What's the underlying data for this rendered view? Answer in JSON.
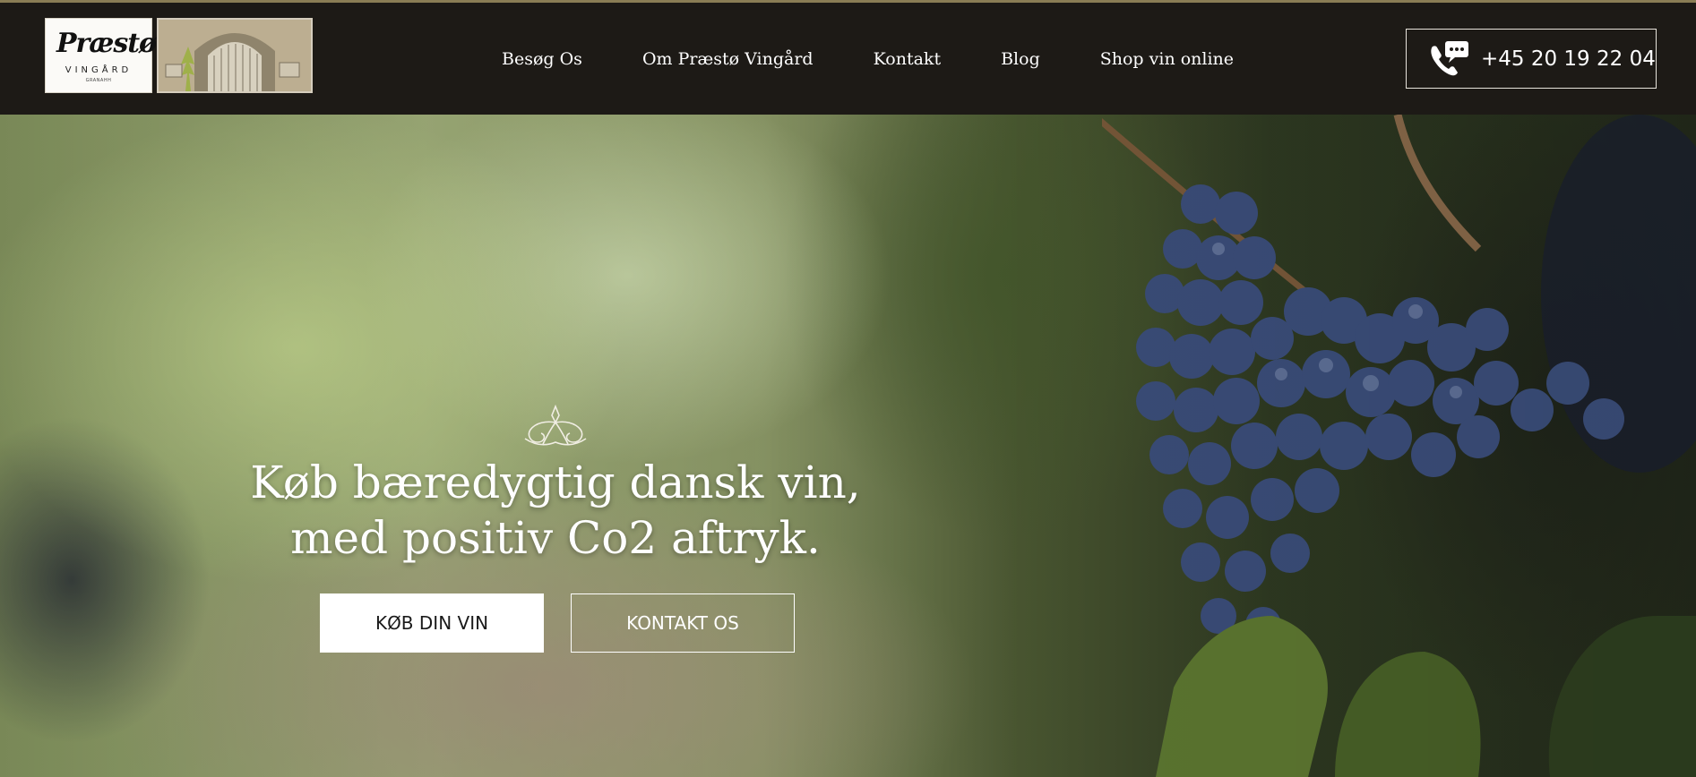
{
  "brand": {
    "logo_text": "Præstø",
    "logo_subtitle": "VINGÅRD",
    "logo_tiny": "GRANAHH"
  },
  "nav": {
    "items": [
      {
        "label": "Besøg Os"
      },
      {
        "label": "Om Præstø Vingård"
      },
      {
        "label": "Kontakt"
      },
      {
        "label": "Blog"
      },
      {
        "label": "Shop vin online"
      }
    ]
  },
  "header": {
    "phone": "+45 20 19 22 04",
    "phone_icon": "phone-chat-icon"
  },
  "hero": {
    "title_line1": "Køb bæredygtig dansk vin,",
    "title_line2": "med positiv Co2 aftryk.",
    "primary_button": "KØB DIN VIN",
    "secondary_button": "KONTAKT OS",
    "ornament_icon": "fleur-ornament-icon"
  },
  "colors": {
    "header_bg": "#1d1a16",
    "accent_line": "#8a7d55",
    "text_light": "#ffffff"
  }
}
